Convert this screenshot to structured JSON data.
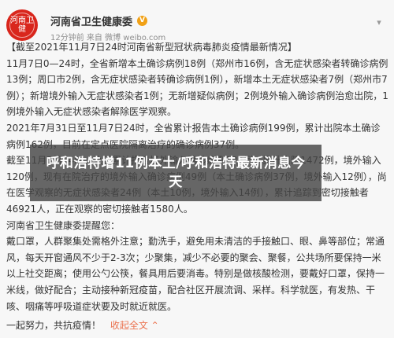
{
  "post": {
    "author": "河南省卫生健康委",
    "verified_badge": "V",
    "meta": "12分钟前 来自 微博 weibo.com",
    "avatar_text": "河南卫健",
    "paragraphs": [
      "【截至2021年11月7日24时河南省新型冠状病毒肺炎疫情最新情况】",
      "11月7日0—24时，全省新增本土确诊病例18例（郑州市16例，含无症状感染者转确诊病例13例；周口市2例，含无症状感染者转确诊病例1例），新增本土无症状感染者7例（郑州市7例）；新增境外输入无症状感染者1例；无新增疑似病例；2例境外输入确诊病例治愈出院，1例境外输入无症状感染者解除医学观察。",
      "2021年7月31日至11月7日24时，全省累计报告本土确诊病例199例，累计出院本土确诊病例162例，目前在定点医院隔离治疗的确诊病例37例。",
      "截至11月7日24时，全省累计报告境外输入确诊病例184例，累计出院1472例，境外输入120例，现有在院治疗的境外输入确诊病例49例（本土确诊病例37例，境外输入12例），尚在医学观察的无症状感染者24例（本土10例，境外输入14例），累计追踪到密切接触者46921人，正在观察的密切接触者1580人。",
      "河南省卫生健康委提醒您：",
      "戴口罩，人群聚集处需格外注意；勤洗手，避免用未清洁的手接触口、眼、鼻等部位；常通风，每天开窗通风不少于2-3次；少聚集，减少不必要的聚会、聚餐，公共场所要保持一米以上社交距离；使用公勺公筷，餐具用后要消毒。特别是做核酸检测，要戴好口罩，保持一米线，做好配合；主动接种新冠疫苗，配合社区开展流调、采样。科学就医，有发热、干咳、咽痛等呼吸道症状要及时就近就医。"
    ],
    "footer_text": "一起努力，共抗疫情！",
    "footer_link": "收起全文 ⌃"
  },
  "overlay": {
    "title": "呼和浩特增11例本土/呼和浩特最新消息今天"
  },
  "icons": {
    "chevron": "chevron-down-icon"
  }
}
